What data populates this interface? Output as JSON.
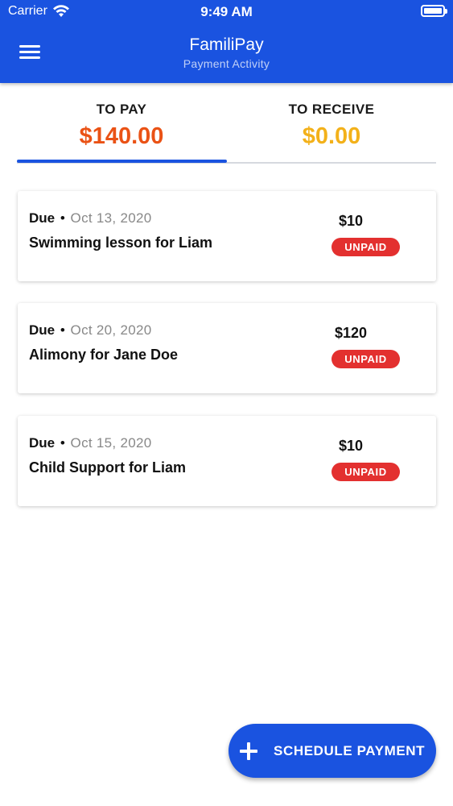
{
  "status_bar": {
    "carrier": "Carrier",
    "time": "9:49 AM",
    "wifi_icon": "wifi-icon",
    "battery_icon": "battery-icon"
  },
  "app_bar": {
    "title": "FamiliPay",
    "subtitle": "Payment Activity",
    "menu_icon": "hamburger-menu-icon"
  },
  "tabs": [
    {
      "label": "TO PAY",
      "amount": "$140.00",
      "color": "#ea5215",
      "selected": true
    },
    {
      "label": "TO RECEIVE",
      "amount": "$0.00",
      "color": "#f3b11a",
      "selected": false
    }
  ],
  "payments": [
    {
      "due_label": "Due",
      "separator": "•",
      "date": "Oct 13, 2020",
      "title": "Swimming lesson for Liam",
      "amount": "$10",
      "status": "UNPAID"
    },
    {
      "due_label": "Due",
      "separator": "•",
      "date": "Oct 20, 2020",
      "title": "Alimony for Jane Doe",
      "amount": "$120",
      "status": "UNPAID"
    },
    {
      "due_label": "Due",
      "separator": "•",
      "date": "Oct 15, 2020",
      "title": "Child Support for Liam",
      "amount": "$10",
      "status": "UNPAID"
    }
  ],
  "fab": {
    "label": "SCHEDULE PAYMENT",
    "icon": "plus-icon"
  },
  "colors": {
    "primary": "#1a53e0",
    "to_pay": "#ea5215",
    "to_receive": "#f3b11a",
    "unpaid_badge": "#e3302f"
  }
}
